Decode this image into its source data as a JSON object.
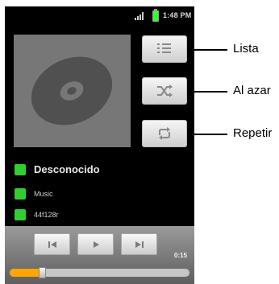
{
  "status_bar": {
    "time": "1:48 PM",
    "signal_icon": "signal-bars-icon",
    "battery_icon": "battery-icon",
    "battery_color": "#33ff33"
  },
  "album_art": {
    "icon": "compact-disc-icon"
  },
  "side_buttons": [
    {
      "id": "lista",
      "icon": "list-icon"
    },
    {
      "id": "al-azar",
      "icon": "shuffle-icon"
    },
    {
      "id": "repetir",
      "icon": "repeat-icon"
    }
  ],
  "track_info": {
    "artist": "Desconocido",
    "album": "Music",
    "title": "44f128r"
  },
  "player": {
    "elapsed": "0:15",
    "progress": 0.18,
    "progress_color": "#ffa500",
    "buttons": [
      "previous-icon",
      "play-icon",
      "next-icon"
    ]
  },
  "callouts": {
    "lista": "Lista",
    "al_azar": "Al azar",
    "repetir": "Repetir"
  }
}
